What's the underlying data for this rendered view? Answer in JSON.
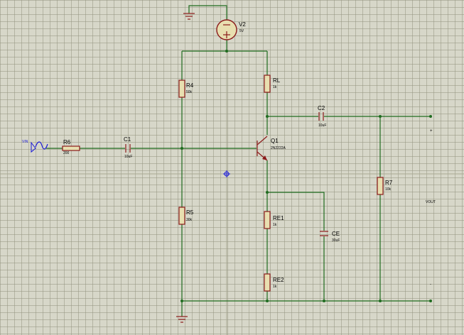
{
  "components": {
    "V2": {
      "ref": "V2",
      "value": "5V"
    },
    "R4": {
      "ref": "R4",
      "value": "50k"
    },
    "R5": {
      "ref": "R5",
      "value": "30k"
    },
    "R6": {
      "ref": "R6",
      "value": "200"
    },
    "RL": {
      "ref": "RL",
      "value": "1k"
    },
    "RE1": {
      "ref": "RE1",
      "value": "1k"
    },
    "RE2": {
      "ref": "RE2",
      "value": "1k"
    },
    "R7": {
      "ref": "R7",
      "value": "10k"
    },
    "C1": {
      "ref": "C1",
      "value": "10uF"
    },
    "C2": {
      "ref": "C2",
      "value": "10uF"
    },
    "CE": {
      "ref": "CE",
      "value": "30uF"
    },
    "Q1": {
      "ref": "Q1",
      "value": "2N2222A"
    }
  },
  "labels": {
    "vin": "VIN",
    "vout": "VOUT",
    "out_plus": "+",
    "out_minus": "-"
  },
  "colors": {
    "background": "#d7d7c9",
    "wire": "#1f6b1f",
    "component": "#8b1a1a",
    "resistor_fill": "#e8dfb0",
    "probe": "#1a1ad6"
  }
}
